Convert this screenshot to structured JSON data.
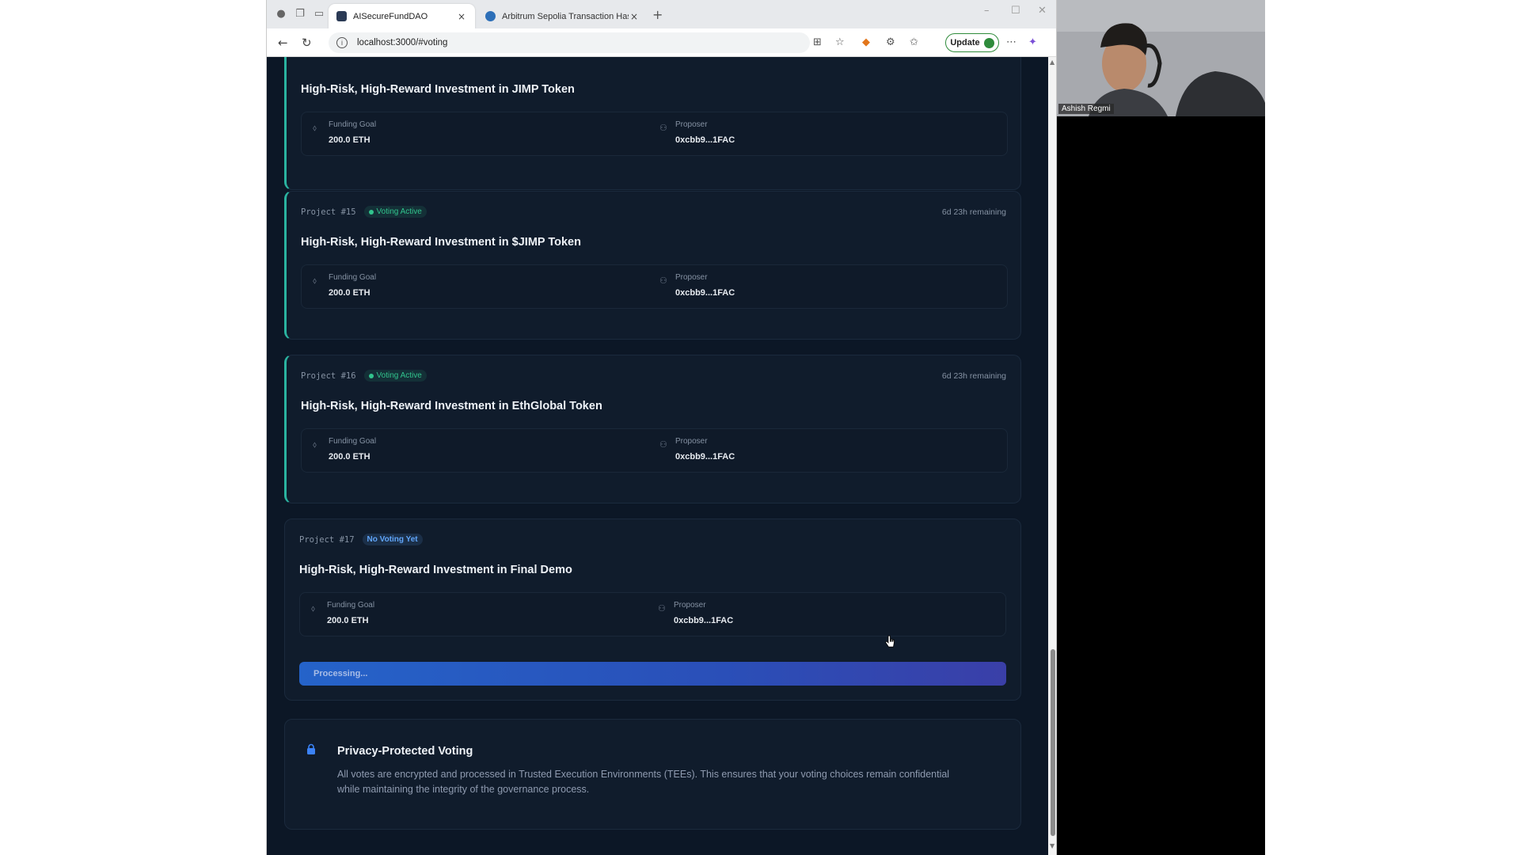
{
  "browser": {
    "tabs": [
      {
        "title": "AISecureFundDAO",
        "active": true
      },
      {
        "title": "Arbitrum Sepolia Transaction Has",
        "active": false
      }
    ],
    "url": "localhost:3000/#voting",
    "update_label": "Update"
  },
  "projects": [
    {
      "number": "",
      "status": "",
      "remaining": "",
      "title": "High-Risk, High-Reward Investment in JIMP Token",
      "funding_label": "Funding Goal",
      "funding_value": "200.0 ETH",
      "proposer_label": "Proposer",
      "proposer_value": "0xcbb9...1FAC"
    },
    {
      "number": "Project #15",
      "status": "Voting Active",
      "remaining": "6d 23h remaining",
      "title": "High-Risk, High-Reward Investment in $JIMP Token",
      "funding_label": "Funding Goal",
      "funding_value": "200.0 ETH",
      "proposer_label": "Proposer",
      "proposer_value": "0xcbb9...1FAC"
    },
    {
      "number": "Project #16",
      "status": "Voting Active",
      "remaining": "6d 23h remaining",
      "title": "High-Risk, High-Reward Investment in EthGlobal Token",
      "funding_label": "Funding Goal",
      "funding_value": "200.0 ETH",
      "proposer_label": "Proposer",
      "proposer_value": "0xcbb9...1FAC"
    },
    {
      "number": "Project #17",
      "status": "No Voting Yet",
      "remaining": "",
      "title": "High-Risk, High-Reward Investment in Final Demo",
      "funding_label": "Funding Goal",
      "funding_value": "200.0 ETH",
      "proposer_label": "Proposer",
      "proposer_value": "0xcbb9...1FAC",
      "button_label": "Processing..."
    }
  ],
  "privacy": {
    "title": "Privacy-Protected Voting",
    "text": "All votes are encrypted and processed in Trusted Execution Environments (TEEs). This ensures that your voting choices remain confidential while maintaining the integrity of the governance process."
  },
  "webcam": {
    "name": "Ashish Regmi"
  },
  "colors": {
    "page_bg": "#0c1726",
    "card_bg": "#101c2c",
    "active_accent": "#2ab3a0",
    "voting_green": "#31c48d",
    "no_voting_blue": "#60a5fa",
    "button_blue": "#2563c9"
  }
}
